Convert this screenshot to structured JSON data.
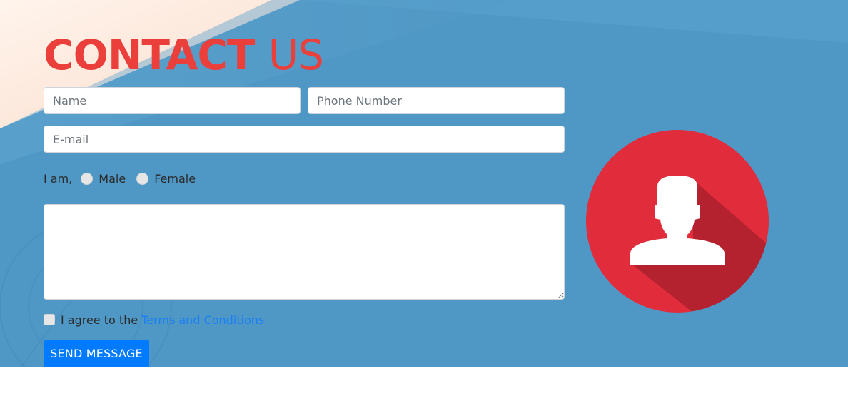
{
  "contact": {
    "title_bold": "CONTACT",
    "title_light": "US",
    "name_placeholder": "Name",
    "phone_placeholder": "Phone Number",
    "email_placeholder": "E-mail",
    "gender_lead": "I am,",
    "gender_options": [
      "Male",
      "Female"
    ],
    "message_value": "",
    "agree_text": "I agree to the",
    "agree_link": "Terms and Conditions",
    "submit_label": "SEND MESSAGE"
  },
  "avatar": {
    "icon": "user-icon"
  },
  "colors": {
    "accent_red": "#ea3f3b",
    "hero_blue": "#4f97c5",
    "button_blue": "#007bff",
    "link_blue": "#1a7ff5",
    "avatar_red": "#e12c3c",
    "avatar_shadow": "#b3222e"
  }
}
